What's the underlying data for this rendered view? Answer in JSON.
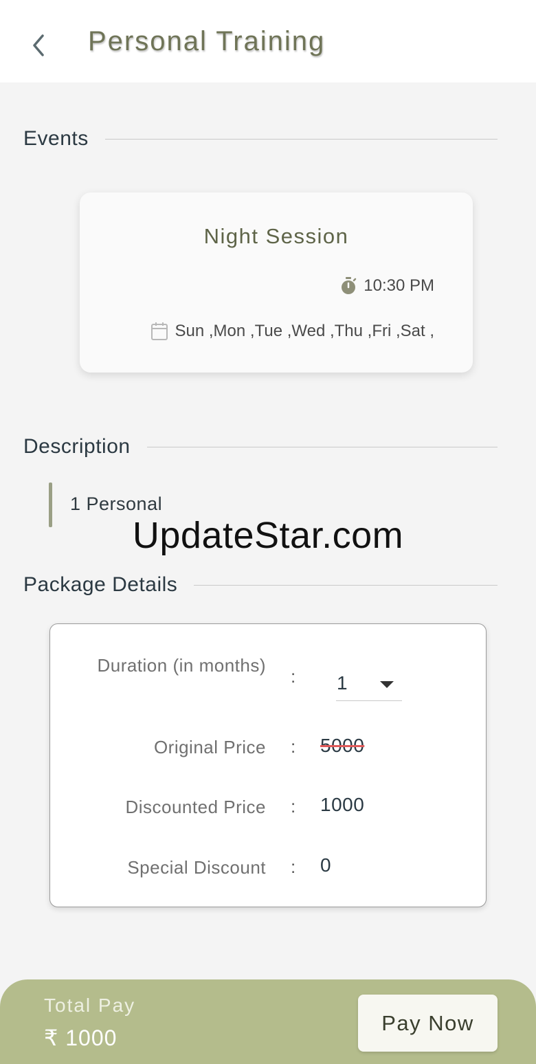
{
  "header": {
    "title": "Personal Training",
    "back_icon": "chevron-left-icon"
  },
  "sections": {
    "events": "Events",
    "description": "Description",
    "package_details": "Package Details"
  },
  "event": {
    "name": "Night Session",
    "time": "10:30 PM",
    "days": "Sun ,Mon ,Tue ,Wed ,Thu ,Fri ,Sat ,",
    "time_icon": "stopwatch-icon",
    "days_icon": "calendar-icon"
  },
  "description": {
    "text": "1 Personal"
  },
  "watermark": "UpdateStar.com",
  "package": {
    "duration_label": "Duration (in months)",
    "duration_value": "1",
    "original_price_label": "Original Price",
    "original_price_value": "5000",
    "discounted_price_label": "Discounted Price",
    "discounted_price_value": "1000",
    "special_discount_label": "Special Discount",
    "special_discount_value": "0",
    "separator": ":"
  },
  "footer": {
    "total_label": "Total Pay",
    "total_amount": "₹ 1000",
    "pay_button": "Pay Now"
  },
  "colors": {
    "accent": "#b4bc8c",
    "title": "#6f7457",
    "strike": "#e05a5a",
    "background": "#f4f4f4"
  }
}
